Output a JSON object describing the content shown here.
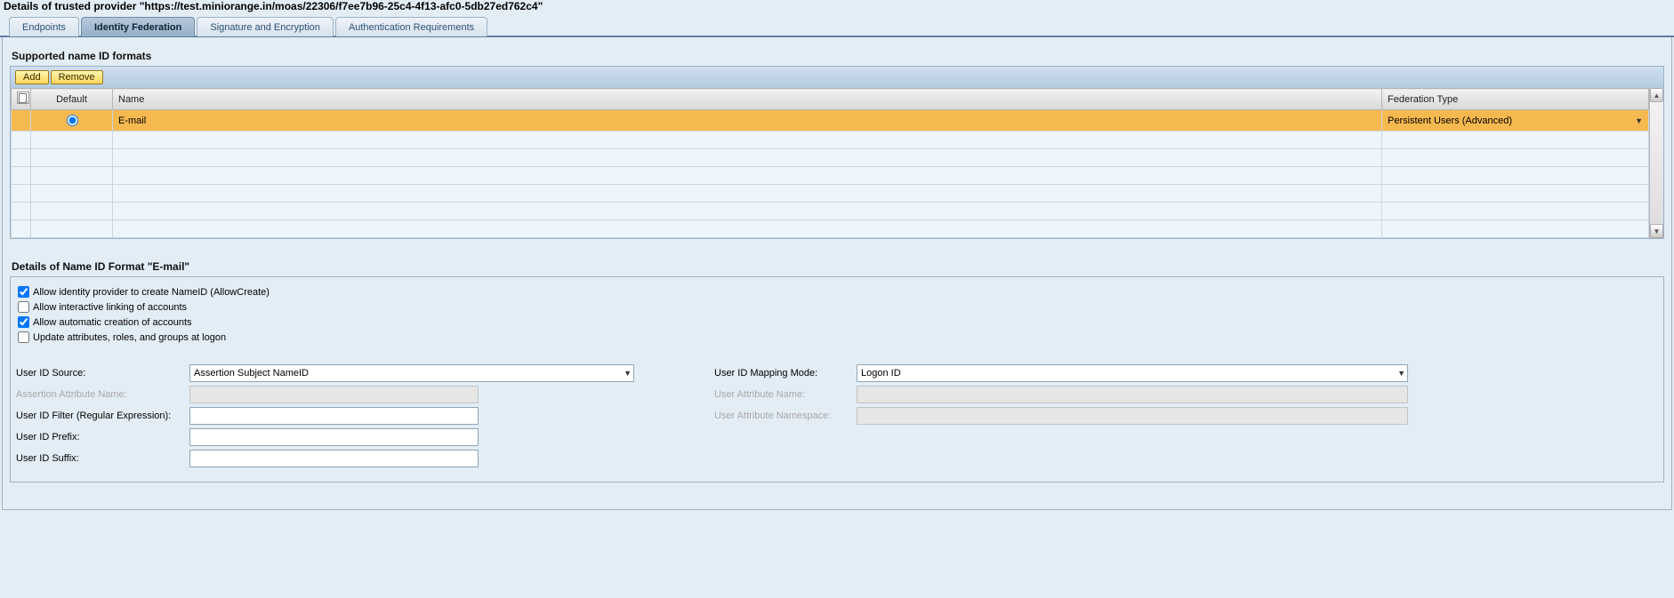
{
  "page_title": "Details of trusted provider \"https://test.miniorange.in/moas/22306/f7ee7b96-25c4-4f13-afc0-5db27ed762c4\"",
  "tabs": [
    {
      "label": "Endpoints"
    },
    {
      "label": "Identity Federation"
    },
    {
      "label": "Signature and Encryption"
    },
    {
      "label": "Authentication Requirements"
    }
  ],
  "active_tab_index": 1,
  "section1": {
    "title": "Supported name ID formats",
    "add_label": "Add",
    "remove_label": "Remove",
    "col_default": "Default",
    "col_name": "Name",
    "col_fed": "Federation Type",
    "row": {
      "name": "E-mail",
      "fed_type": "Persistent Users (Advanced)"
    }
  },
  "section2": {
    "title": "Details of Name ID Format \"E-mail\"",
    "chk1": "Allow identity provider to create NameID (AllowCreate)",
    "chk2": "Allow interactive linking of accounts",
    "chk3": "Allow automatic creation of accounts",
    "chk4": "Update attributes, roles, and groups at logon",
    "left": {
      "user_id_source_label": "User ID Source:",
      "user_id_source_value": "Assertion Subject NameID",
      "assertion_attr_label": "Assertion Attribute Name:",
      "assertion_attr_value": "",
      "user_id_filter_label": "User ID Filter (Regular Expression):",
      "user_id_filter_value": "",
      "user_id_prefix_label": "User ID Prefix:",
      "user_id_prefix_value": "",
      "user_id_suffix_label": "User ID Suffix:",
      "user_id_suffix_value": ""
    },
    "right": {
      "mapping_mode_label": "User ID Mapping Mode:",
      "mapping_mode_value": "Logon ID",
      "user_attr_name_label": "User Attribute Name:",
      "user_attr_name_value": "",
      "user_attr_ns_label": "User Attribute Namespace:",
      "user_attr_ns_value": ""
    }
  }
}
